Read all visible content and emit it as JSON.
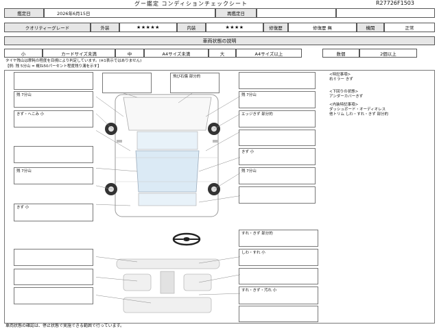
{
  "header": {
    "title": "グー鑑定 コンディションチェックシート",
    "sheet_id": "R27726F1503"
  },
  "row1": {
    "date_label": "鑑定日",
    "date_value": "2026年6月15日",
    "recheck_label": "再鑑定日",
    "recheck_value": ""
  },
  "row2": {
    "grade_label": "クオリティーグレード",
    "exterior_label": "外装",
    "exterior_stars": "★★★★★",
    "interior_label": "内装",
    "interior_stars": "★★★★",
    "repair_label": "修復歴",
    "repair_value": "修復歴 無",
    "engine_label": "機関",
    "engine_value": "正常"
  },
  "section_title": "車両状態の説明",
  "legend": {
    "small_label": "小",
    "small_value": "カードサイズ未満",
    "medium_label": "中",
    "medium_value": "A4サイズ未満",
    "large_label": "大",
    "large_value": "A4サイズ以上",
    "count_label": "数個",
    "count_value": "2個以上"
  },
  "tire_note_1": "タイヤ残山は摩耗の程度を目視により判定しています。(※1表示ではありません)",
  "tire_note_2": "【例: 残 5分山 = 概ね50パーセント程度残り溝を示す】",
  "left_boxes": [
    "",
    "残 7分山",
    "きず・へこみ 小",
    "",
    "残 7分山",
    "きず 小"
  ],
  "top_center_boxes": [
    "",
    "飛び石傷 部分的"
  ],
  "right_boxes": [
    "",
    "残 7分山",
    "エッジきず 部分的",
    "",
    "きず 小",
    "残 7分山",
    ""
  ],
  "lower_left_boxes": [
    "",
    "",
    ""
  ],
  "lower_right_boxes": [
    "すれ・きず 部分的",
    "しわ・すれ 小",
    "",
    "すれ・きず・汚れ 小"
  ],
  "special_notes": {
    "heading1": "<特記事項>",
    "line1": "右ミラー きず",
    "heading2": "<下回りの状態>",
    "line2": "アンダーカバーきず",
    "heading3": "<内装特記事項>",
    "line3": "ダッシュボード・オーディオレス",
    "line4": "他トリム しわ・すれ・きず 部分的"
  },
  "footer_note": "車両状態の確認は、停止状態で実施できる範囲で行っています。"
}
